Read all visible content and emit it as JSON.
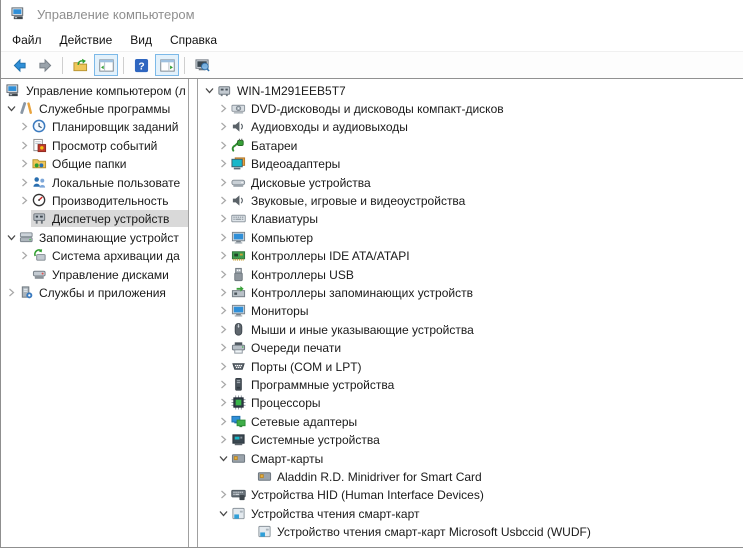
{
  "window": {
    "title": "Управление компьютером",
    "icon": "computer-icon"
  },
  "menu": {
    "items": [
      "Файл",
      "Действие",
      "Вид",
      "Справка"
    ]
  },
  "toolbar": {
    "buttons": [
      {
        "name": "back-button",
        "icon": "back-arrow-icon",
        "toggled": false
      },
      {
        "name": "forward-button",
        "icon": "forward-arrow-icon",
        "toggled": false
      },
      {
        "sep": true
      },
      {
        "name": "export-list-button",
        "icon": "folder-arrow-icon",
        "toggled": false
      },
      {
        "name": "toggle-console-tree-button",
        "icon": "window-tree-icon",
        "toggled": true
      },
      {
        "sep": true
      },
      {
        "name": "help-button",
        "icon": "help-icon",
        "toggled": false
      },
      {
        "name": "toggle-action-pane-button",
        "icon": "window-pane-icon",
        "toggled": true
      },
      {
        "sep": true
      },
      {
        "name": "console-button",
        "icon": "console-monitor-icon",
        "toggled": false
      }
    ]
  },
  "left_tree": {
    "items": [
      {
        "label": "Управление компьютером (л",
        "icon": "computer-management-icon",
        "level": 0,
        "chevron": "none",
        "selected": false
      },
      {
        "label": "Служебные программы",
        "icon": "system-tools-icon",
        "level": 1,
        "chevron": "expanded",
        "selected": false
      },
      {
        "label": "Планировщик заданий",
        "icon": "task-scheduler-icon",
        "level": 2,
        "chevron": "collapsed",
        "selected": false
      },
      {
        "label": "Просмотр событий",
        "icon": "event-viewer-icon",
        "level": 2,
        "chevron": "collapsed",
        "selected": false
      },
      {
        "label": "Общие папки",
        "icon": "shared-folders-icon",
        "level": 2,
        "chevron": "collapsed",
        "selected": false
      },
      {
        "label": "Локальные пользовате",
        "icon": "local-users-icon",
        "level": 2,
        "chevron": "collapsed",
        "selected": false
      },
      {
        "label": "Производительность",
        "icon": "performance-icon",
        "level": 2,
        "chevron": "collapsed",
        "selected": false
      },
      {
        "label": "Диспетчер устройств",
        "icon": "device-manager-icon",
        "level": 2,
        "chevron": "none",
        "selected": true
      },
      {
        "label": "Запоминающие устройст",
        "icon": "storage-icon",
        "level": 1,
        "chevron": "expanded",
        "selected": false
      },
      {
        "label": "Система архивации да",
        "icon": "backup-icon",
        "level": 2,
        "chevron": "collapsed",
        "selected": false
      },
      {
        "label": "Управление дисками",
        "icon": "disk-management-icon",
        "level": 2,
        "chevron": "none",
        "selected": false
      },
      {
        "label": "Службы и приложения",
        "icon": "services-icon",
        "level": 1,
        "chevron": "collapsed",
        "selected": false
      }
    ]
  },
  "right_tree": {
    "items": [
      {
        "label": "WIN-1M291EEB5T7",
        "icon": "computer-case-icon",
        "level": 0,
        "chevron": "expanded",
        "selected": false
      },
      {
        "label": "DVD-дисководы и дисководы компакт-дисков",
        "icon": "dvd-drive-icon",
        "level": 1,
        "chevron": "collapsed",
        "selected": false
      },
      {
        "label": "Аудиовходы и аудиовыходы",
        "icon": "audio-icon",
        "level": 1,
        "chevron": "collapsed",
        "selected": false
      },
      {
        "label": "Батареи",
        "icon": "battery-icon",
        "level": 1,
        "chevron": "collapsed",
        "selected": false
      },
      {
        "label": "Видеоадаптеры",
        "icon": "video-adapter-icon",
        "level": 1,
        "chevron": "collapsed",
        "selected": false
      },
      {
        "label": "Дисковые устройства",
        "icon": "disk-drive-icon",
        "level": 1,
        "chevron": "collapsed",
        "selected": false
      },
      {
        "label": "Звуковые, игровые и видеоустройства",
        "icon": "audio-icon",
        "level": 1,
        "chevron": "collapsed",
        "selected": false
      },
      {
        "label": "Клавиатуры",
        "icon": "keyboard-icon",
        "level": 1,
        "chevron": "collapsed",
        "selected": false
      },
      {
        "label": "Компьютер",
        "icon": "monitor-icon",
        "level": 1,
        "chevron": "collapsed",
        "selected": false
      },
      {
        "label": "Контроллеры IDE ATA/ATAPI",
        "icon": "ide-controller-icon",
        "level": 1,
        "chevron": "collapsed",
        "selected": false
      },
      {
        "label": "Контроллеры USB",
        "icon": "usb-icon",
        "level": 1,
        "chevron": "collapsed",
        "selected": false
      },
      {
        "label": "Контроллеры запоминающих устройств",
        "icon": "storage-controller-icon",
        "level": 1,
        "chevron": "collapsed",
        "selected": false
      },
      {
        "label": "Мониторы",
        "icon": "monitor-icon",
        "level": 1,
        "chevron": "collapsed",
        "selected": false
      },
      {
        "label": "Мыши и иные указывающие устройства",
        "icon": "mouse-icon",
        "level": 1,
        "chevron": "collapsed",
        "selected": false
      },
      {
        "label": "Очереди печати",
        "icon": "printer-icon",
        "level": 1,
        "chevron": "collapsed",
        "selected": false
      },
      {
        "label": "Порты (COM и LPT)",
        "icon": "port-icon",
        "level": 1,
        "chevron": "collapsed",
        "selected": false
      },
      {
        "label": "Программные устройства",
        "icon": "software-device-icon",
        "level": 1,
        "chevron": "collapsed",
        "selected": false
      },
      {
        "label": "Процессоры",
        "icon": "processor-icon",
        "level": 1,
        "chevron": "collapsed",
        "selected": false
      },
      {
        "label": "Сетевые адаптеры",
        "icon": "network-adapter-icon",
        "level": 1,
        "chevron": "collapsed",
        "selected": false
      },
      {
        "label": "Системные устройства",
        "icon": "system-device-icon",
        "level": 1,
        "chevron": "collapsed",
        "selected": false
      },
      {
        "label": "Смарт-карты",
        "icon": "smart-card-icon",
        "level": 1,
        "chevron": "expanded",
        "selected": false
      },
      {
        "label": "Aladdin R.D. Minidriver for Smart Card",
        "icon": "smart-card-icon",
        "level": 2,
        "chevron": "none",
        "selected": false
      },
      {
        "label": "Устройства HID (Human Interface Devices)",
        "icon": "hid-icon",
        "level": 1,
        "chevron": "collapsed",
        "selected": false
      },
      {
        "label": "Устройства чтения смарт-карт",
        "icon": "card-reader-icon",
        "level": 1,
        "chevron": "expanded",
        "selected": false
      },
      {
        "label": "Устройство чтения смарт-карт Microsoft Usbccid (WUDF)",
        "icon": "card-reader-icon",
        "level": 2,
        "chevron": "none",
        "selected": false
      }
    ]
  },
  "colors": {
    "selection_bg": "#d9d9d9",
    "toolbar_toggle_bg": "#e3f1fb",
    "toolbar_toggle_border": "#7cb9e8",
    "panel_border": "#a0a0a0",
    "title_text": "#8f8f8f",
    "chevron_collapsed": "#a8a8a8",
    "chevron_expanded": "#484848"
  }
}
